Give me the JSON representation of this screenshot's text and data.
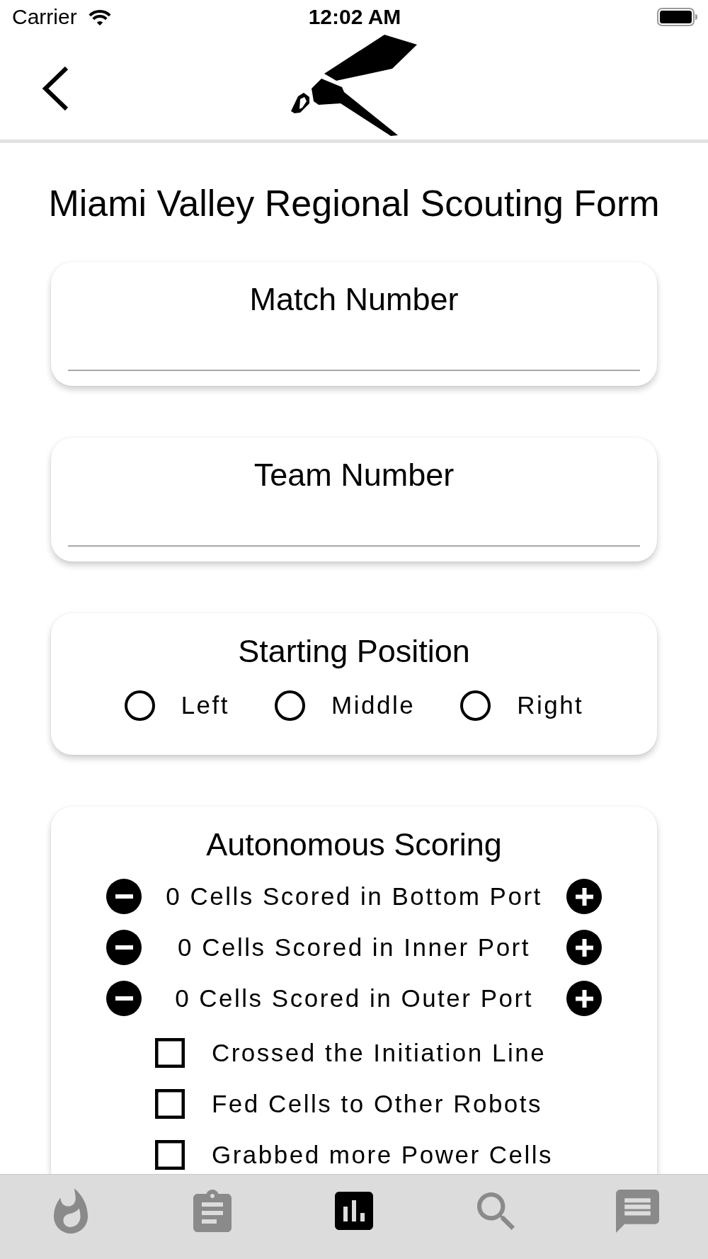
{
  "status_bar": {
    "carrier": "Carrier",
    "time": "12:02 AM"
  },
  "form": {
    "title": "Miami Valley Regional Scouting Form",
    "sections": [
      {
        "kind": "text_field",
        "title": "Match Number"
      },
      {
        "kind": "text_field",
        "title": "Team Number"
      },
      {
        "kind": "radio_group",
        "title": "Starting Position",
        "options": [
          {
            "label": "Left",
            "selected": false
          },
          {
            "label": "Middle",
            "selected": false
          },
          {
            "label": "Right",
            "selected": false
          }
        ]
      },
      {
        "kind": "scoring",
        "title": "Autonomous Scoring",
        "counters": [
          {
            "label": "0 Cells Scored in Bottom Port"
          },
          {
            "label": "0 Cells Scored in Inner Port"
          },
          {
            "label": "0 Cells Scored in Outer Port"
          }
        ],
        "checkboxes": [
          {
            "label": "Crossed the Initiation Line",
            "checked": false
          },
          {
            "label": "Fed Cells to Other Robots",
            "checked": false
          },
          {
            "label": "Grabbed more Power Cells",
            "checked": false
          }
        ]
      }
    ]
  },
  "tab_bar": {
    "tabs": [
      {
        "selected": false
      },
      {
        "selected": false
      },
      {
        "selected": true
      },
      {
        "selected": false
      },
      {
        "selected": false
      }
    ]
  }
}
